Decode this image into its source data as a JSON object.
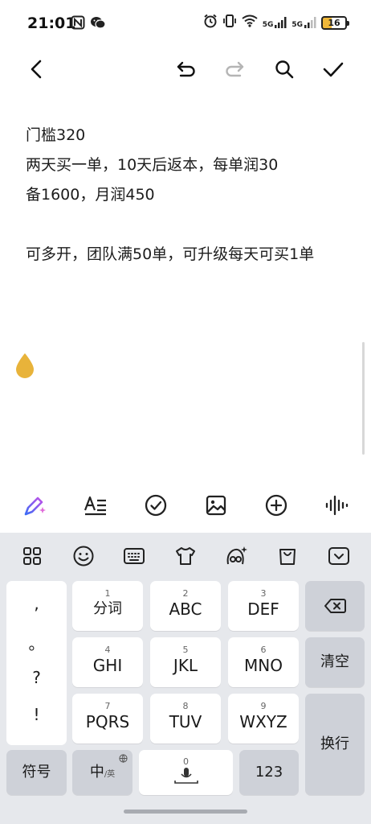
{
  "status_bar": {
    "time": "21:01",
    "network_5g_1": "5G",
    "network_5g_2": "5G",
    "battery": "16"
  },
  "note": {
    "lines": [
      "门槛320",
      "两天买一单，10天后返本，每单润30",
      "备1600，月润450",
      "",
      "可多开，团队满50单，可升级每天可买1单"
    ]
  },
  "keyboard": {
    "punctuation": [
      ",",
      "。",
      "?",
      "!"
    ],
    "keys": [
      {
        "num": "1",
        "label": "分词"
      },
      {
        "num": "2",
        "label": "ABC"
      },
      {
        "num": "3",
        "label": "DEF"
      },
      {
        "num": "4",
        "label": "GHI"
      },
      {
        "num": "5",
        "label": "JKL"
      },
      {
        "num": "6",
        "label": "MNO"
      },
      {
        "num": "7",
        "label": "PQRS"
      },
      {
        "num": "8",
        "label": "TUV"
      },
      {
        "num": "9",
        "label": "WXYZ"
      }
    ],
    "clear_label": "清空",
    "newline_label": "换行",
    "symbols_label": "符号",
    "lang_label": "中",
    "lang_sub": "/英",
    "space_num": "0",
    "numbers_label": "123"
  },
  "colors": {
    "accent_drop": "#e8b33a",
    "keyboard_bg": "#e6e8ec",
    "key_gray": "#ced1d8"
  },
  "icons": {
    "top_toolbar": [
      "back-icon",
      "undo-icon",
      "redo-icon",
      "search-icon",
      "checkmark-icon"
    ],
    "format_toolbar": [
      "ai-pen-icon",
      "text-format-icon",
      "checklist-icon",
      "image-icon",
      "add-circle-icon",
      "voice-wave-icon"
    ],
    "keyboard_toolbar": [
      "grid-icon",
      "emoji-icon",
      "keyboard-icon",
      "shirt-icon",
      "ai-assistant-icon",
      "bag-icon",
      "collapse-keyboard-icon"
    ]
  }
}
